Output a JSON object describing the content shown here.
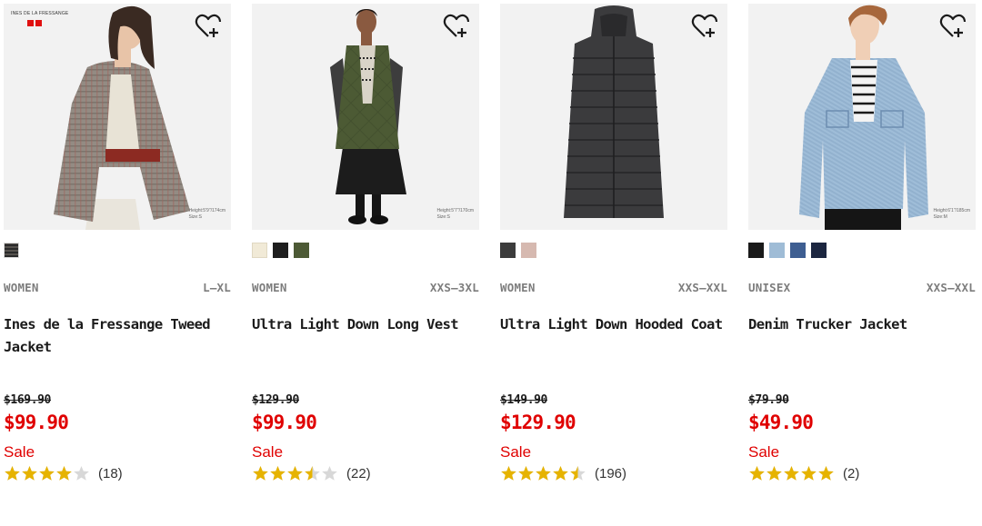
{
  "colors": {
    "sale_red": "#e00000",
    "star_gold": "#e6b300",
    "star_empty": "#d8d8d8",
    "text_dark": "#1b1b1b",
    "text_gray": "#7d7d7d",
    "photo_bg": "#f2f2f2"
  },
  "favorite_icon": "heart-plus-icon",
  "products": [
    {
      "brand_logo_text": "INES DE LA FRESSANGE",
      "model_note": "Height:5'9\"/174cm\nSize:S",
      "swatches": [
        "#6b6560"
      ],
      "category": "WOMEN",
      "sizes": "L–XL",
      "name": "Ines de la Fressange Tweed Jacket",
      "original_price": "$169.90",
      "price": "$99.90",
      "sale_label": "Sale",
      "rating": 4,
      "review_count": "(18)"
    },
    {
      "brand_logo_text": "",
      "model_note": "Height:5'7\"/170cm\nSize:S",
      "swatches": [
        "#f1ead7",
        "#1e1e1e",
        "#4d5a35"
      ],
      "category": "WOMEN",
      "sizes": "XXS–3XL",
      "name": "Ultra Light Down Long Vest",
      "original_price": "$129.90",
      "price": "$99.90",
      "sale_label": "Sale",
      "rating": 3.5,
      "review_count": "(22)"
    },
    {
      "brand_logo_text": "",
      "model_note": "",
      "swatches": [
        "#3c3c3c",
        "#d6b9b0"
      ],
      "category": "WOMEN",
      "sizes": "XXS–XXL",
      "name": "Ultra Light Down Hooded Coat",
      "original_price": "$149.90",
      "price": "$129.90",
      "sale_label": "Sale",
      "rating": 4.5,
      "review_count": "(196)"
    },
    {
      "brand_logo_text": "",
      "model_note": "Height:6'1\"/185cm\nSize:M",
      "swatches": [
        "#1a1a1a",
        "#9fbcd6",
        "#3e5e91",
        "#1c2640"
      ],
      "category": "UNISEX",
      "sizes": "XXS–XXL",
      "name": "Denim Trucker Jacket",
      "original_price": "$79.90",
      "price": "$49.90",
      "sale_label": "Sale",
      "rating": 5,
      "review_count": "(2)"
    }
  ]
}
